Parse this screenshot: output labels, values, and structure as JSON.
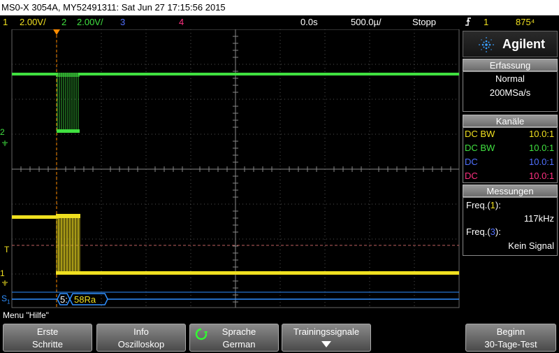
{
  "title": "MS0-X 3054A, MY52491311: Sat Jun 27 17:15:56 2015",
  "status": {
    "ch1": {
      "num": "1",
      "scale": "2.00V/",
      "color": "#f0e020"
    },
    "ch2": {
      "num": "2",
      "scale": "2.00V/",
      "color": "#40e040"
    },
    "ch3": {
      "num": "3",
      "color": "#5070ff"
    },
    "ch4": {
      "num": "4",
      "color": "#ff3080"
    },
    "delay": "0.0s",
    "timebase": "500.0µ/",
    "run_state": "Stopp",
    "trigger_icon": "trigger-edge-icon",
    "trigger_source": "1",
    "trigger_level": "875⁴"
  },
  "brand": {
    "name": "Agilent",
    "icon": "agilent-spark-icon"
  },
  "acquisition": {
    "header": "Erfassung",
    "mode": "Normal",
    "rate": "200MSa/s"
  },
  "channels": {
    "header": "Kanäle",
    "rows": [
      {
        "coupling": "DC BW",
        "probe": "10.0:1",
        "color": "#f0e020"
      },
      {
        "coupling": "DC BW",
        "probe": "10.0:1",
        "color": "#40e040"
      },
      {
        "coupling": "DC",
        "probe": "10.0:1",
        "color": "#5070ff"
      },
      {
        "coupling": "DC",
        "probe": "10.0:1",
        "color": "#ff3080"
      }
    ]
  },
  "measurements": {
    "header": "Messungen",
    "items": [
      {
        "label": "Freq.(",
        "ch": "1",
        "close": "):",
        "ch_color": "#f0e020",
        "value": "117kHz"
      },
      {
        "label": "Freq.(",
        "ch": "3",
        "close": "):",
        "ch_color": "#5070ff",
        "value": "Kein Signal"
      }
    ]
  },
  "markers": {
    "ch2": "2",
    "trig": "T",
    "ch1": "1",
    "serial": "S",
    "serial_sub": "1"
  },
  "serial_decode": {
    "field1": "5:",
    "field2": "58Ra"
  },
  "menu_title": "Menu \"Hilfe\"",
  "softkeys": [
    {
      "line1": "Erste",
      "line2": "Schritte"
    },
    {
      "line1": "Info",
      "line2": "Oszilloskop"
    },
    {
      "line1": "Sprache",
      "line2": "German",
      "icon": "rotate-knob-icon"
    },
    {
      "line1": "Trainingssignale",
      "icon": "arrow-down-icon"
    },
    {
      "line1": "Beginn",
      "line2": "30-Tage-Test"
    }
  ]
}
